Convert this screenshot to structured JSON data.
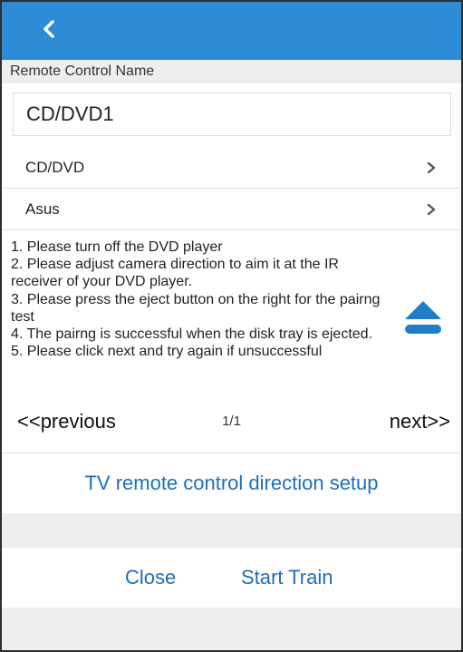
{
  "header": {
    "back_icon": "chevron-left-icon",
    "bar_color": "#2e8bd6"
  },
  "form": {
    "name_label": "Remote Control Name",
    "name_value": "CD/DVD1",
    "device_type": "CD/DVD",
    "brand": "Asus"
  },
  "instructions": {
    "steps": [
      "1. Please turn off the DVD player",
      "2. Please adjust camera direction to aim it at the IR receiver of your DVD player.",
      "3. Please press the eject button on the right for the pairng test",
      "4. The pairng is successful when the disk tray is ejected.",
      "5. Please click next and try again if unsuccessful"
    ],
    "eject_icon": "eject-icon",
    "eject_color": "#1f7fc6"
  },
  "pager": {
    "previous_label": "<<previous",
    "page_indicator": "1/1",
    "next_label": "next>>"
  },
  "setup": {
    "direction_setup_label": "TV remote control direction setup"
  },
  "actions": {
    "close_label": "Close",
    "start_train_label": "Start Train",
    "accent_color": "#1f6fb8"
  }
}
